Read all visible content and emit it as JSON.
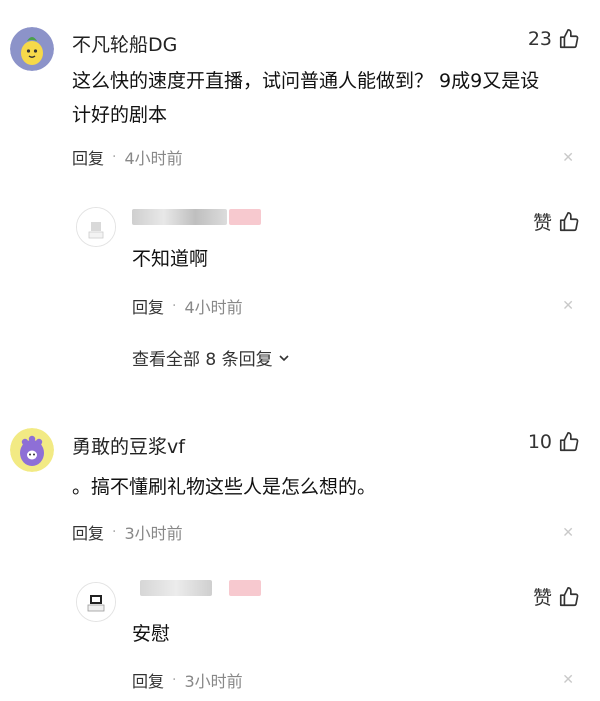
{
  "comments": [
    {
      "username": "不凡轮船DG",
      "likes": "23",
      "text_line1": "这么快的速度开直播，试问普通人能做到？ 9成9又是设",
      "text_line2": "计好的剧本",
      "reply_label": "回复",
      "time": "4小时前",
      "reply": {
        "like_label": "赞",
        "text": "不知道啊",
        "reply_label": "回复",
        "time": "4小时前"
      },
      "view_more": "查看全部 8 条回复"
    },
    {
      "username": "勇敢的豆浆vf",
      "likes": "10",
      "text": "。搞不懂刷礼物这些人是怎么想的。",
      "reply_label": "回复",
      "time": "3小时前",
      "reply": {
        "like_label": "赞",
        "text": "安慰",
        "reply_label": "回复",
        "time": "3小时前"
      }
    }
  ],
  "icons": {
    "like": "thumbs-up-icon",
    "close": "close-icon",
    "expand": "chevron-down-icon"
  },
  "colors": {
    "text": "#222222",
    "meta": "#888888",
    "close": "#c9c9c9"
  }
}
